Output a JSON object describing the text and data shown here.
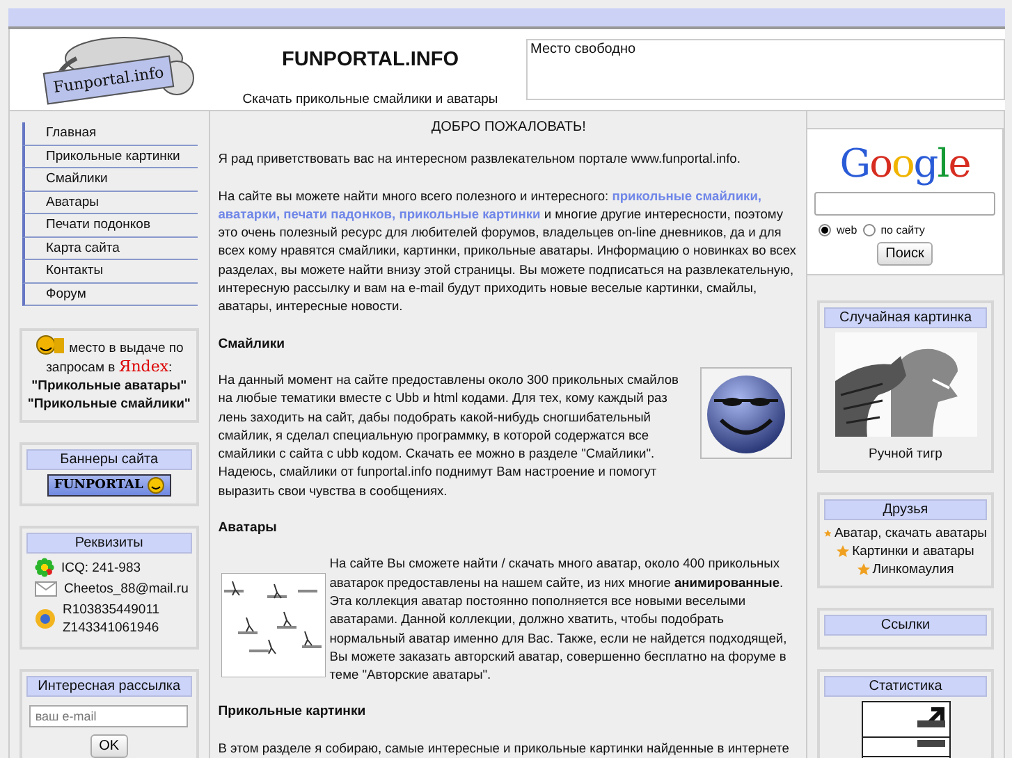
{
  "header": {
    "logo_text": "Funportal.info",
    "title": "FUNPORTAL.INFO",
    "subtitle": "Скачать прикольные смайлики и аватары",
    "ad_text": "Место свободно"
  },
  "nav": {
    "items": [
      {
        "label": "Главная"
      },
      {
        "label": "Прикольные картинки"
      },
      {
        "label": "Смайлики"
      },
      {
        "label": "Аватары"
      },
      {
        "label": "Печати подонков"
      },
      {
        "label": "Карта сайта"
      },
      {
        "label": "Контакты"
      },
      {
        "label": "Форум"
      }
    ]
  },
  "rating": {
    "text": "место в выдаче по запросам в",
    "search_engine": "Яndex",
    "suffix": ":",
    "queries": [
      "\"Прикольные аватары\"",
      "\"Прикольные смайлики\""
    ]
  },
  "banners": {
    "title": "Баннеры сайта",
    "banner_text": "FUNPORTAL"
  },
  "requisites": {
    "title": "Реквизиты",
    "items": [
      {
        "kind": "icq",
        "lines": [
          "ICQ: 241-983"
        ]
      },
      {
        "kind": "email",
        "lines": [
          "Cheetos_88@mail.ru"
        ]
      },
      {
        "kind": "webmoney",
        "lines": [
          "R103835449011",
          "Z143341061946"
        ]
      }
    ]
  },
  "newsletter": {
    "title": "Интересная рассылка",
    "placeholder": "ваш e-mail",
    "button": "OK"
  },
  "main": {
    "heading": "ДОБРО ПОЖАЛОВАТЬ!",
    "intro": "Я рад приветствовать вас на интересном развлекательном портале www.funportal.info.",
    "about": [
      {
        "text": "На сайте вы можете найти много всего полезного и интересного:",
        "link": false
      },
      {
        "text": "прикольные смайлики,",
        "link": true
      },
      {
        "text": "аватарки,",
        "link": true
      },
      {
        "text": "печати падонков,",
        "link": true
      },
      {
        "text": "прикольные картинки",
        "link": true
      },
      {
        "text": "и многие другие интересности, поэтому это очень полезный ресурс для любителей форумов, владельцев on-line дневников, да и для всех кому нравятся смайлики, картинки, прикольные аватары. Информацию о новинках во всех разделах, вы можете найти внизу этой страницы. Вы можете подписаться на развлекательную, интересную рассылку и вам на e-mail будут приходить новые веселые картинки, смайлы, аватары, интересные новости.",
        "link": false
      }
    ],
    "sections": [
      {
        "title": "Смайлики",
        "image": {
          "kind": "smiley"
        },
        "text": "На данный момент на сайте предоставлены около 300 прикольных смайлов на любые тематики вместе с Ubb и html кодами. Для тех, кому каждый раз лень заходить на сайт, дабы подобрать какой-нибудь сногшибательный смайлик, я сделал специальную программку, в которой содержатся все смайлики с сайта с ubb кодом. Скачать ее можно в разделе \"Смайлики\". Надеюсь, смайлики от funportal.info поднимут Вам настроение и помогут выразить свои чувства в сообщениях."
      },
      {
        "title": "Аватары",
        "text": "На сайте Вы сможете найти / скачать много аватар, около 400 прикольных аватарок предоставлены на нашем сайте, из них многие **анимированные**. Эта коллекция аватар постоянно пополняется все новыми веселыми аватарами. Данной коллекции, должно хватить, чтобы подобрать нормальный аватар именно для Вас. Также, если не найдется подходящей, Вы можете заказать авторский аватар, совершенно бесплатно на форуме в теме \"Авторские аватары\"."
      },
      {
        "title": "Прикольные картинки",
        "text": "В этом разделе я собираю, самые интересные и прикольные картинки найденные в интернете"
      }
    ]
  },
  "google": {
    "logo": "Google",
    "radios": [
      {
        "label": "web",
        "selected": true
      },
      {
        "label": "по сайту",
        "selected": false
      }
    ],
    "button": "Поиск"
  },
  "random_picture": {
    "title": "Случайная картинка",
    "caption": "Ручной тигр"
  },
  "friends": {
    "title": "Друзья",
    "links": [
      "Аватар, скачать аватары",
      "Картинки и аватары",
      "Линкомаулия"
    ]
  },
  "links": {
    "title": "Ссылки"
  },
  "statistics": {
    "title": "Статистика"
  }
}
